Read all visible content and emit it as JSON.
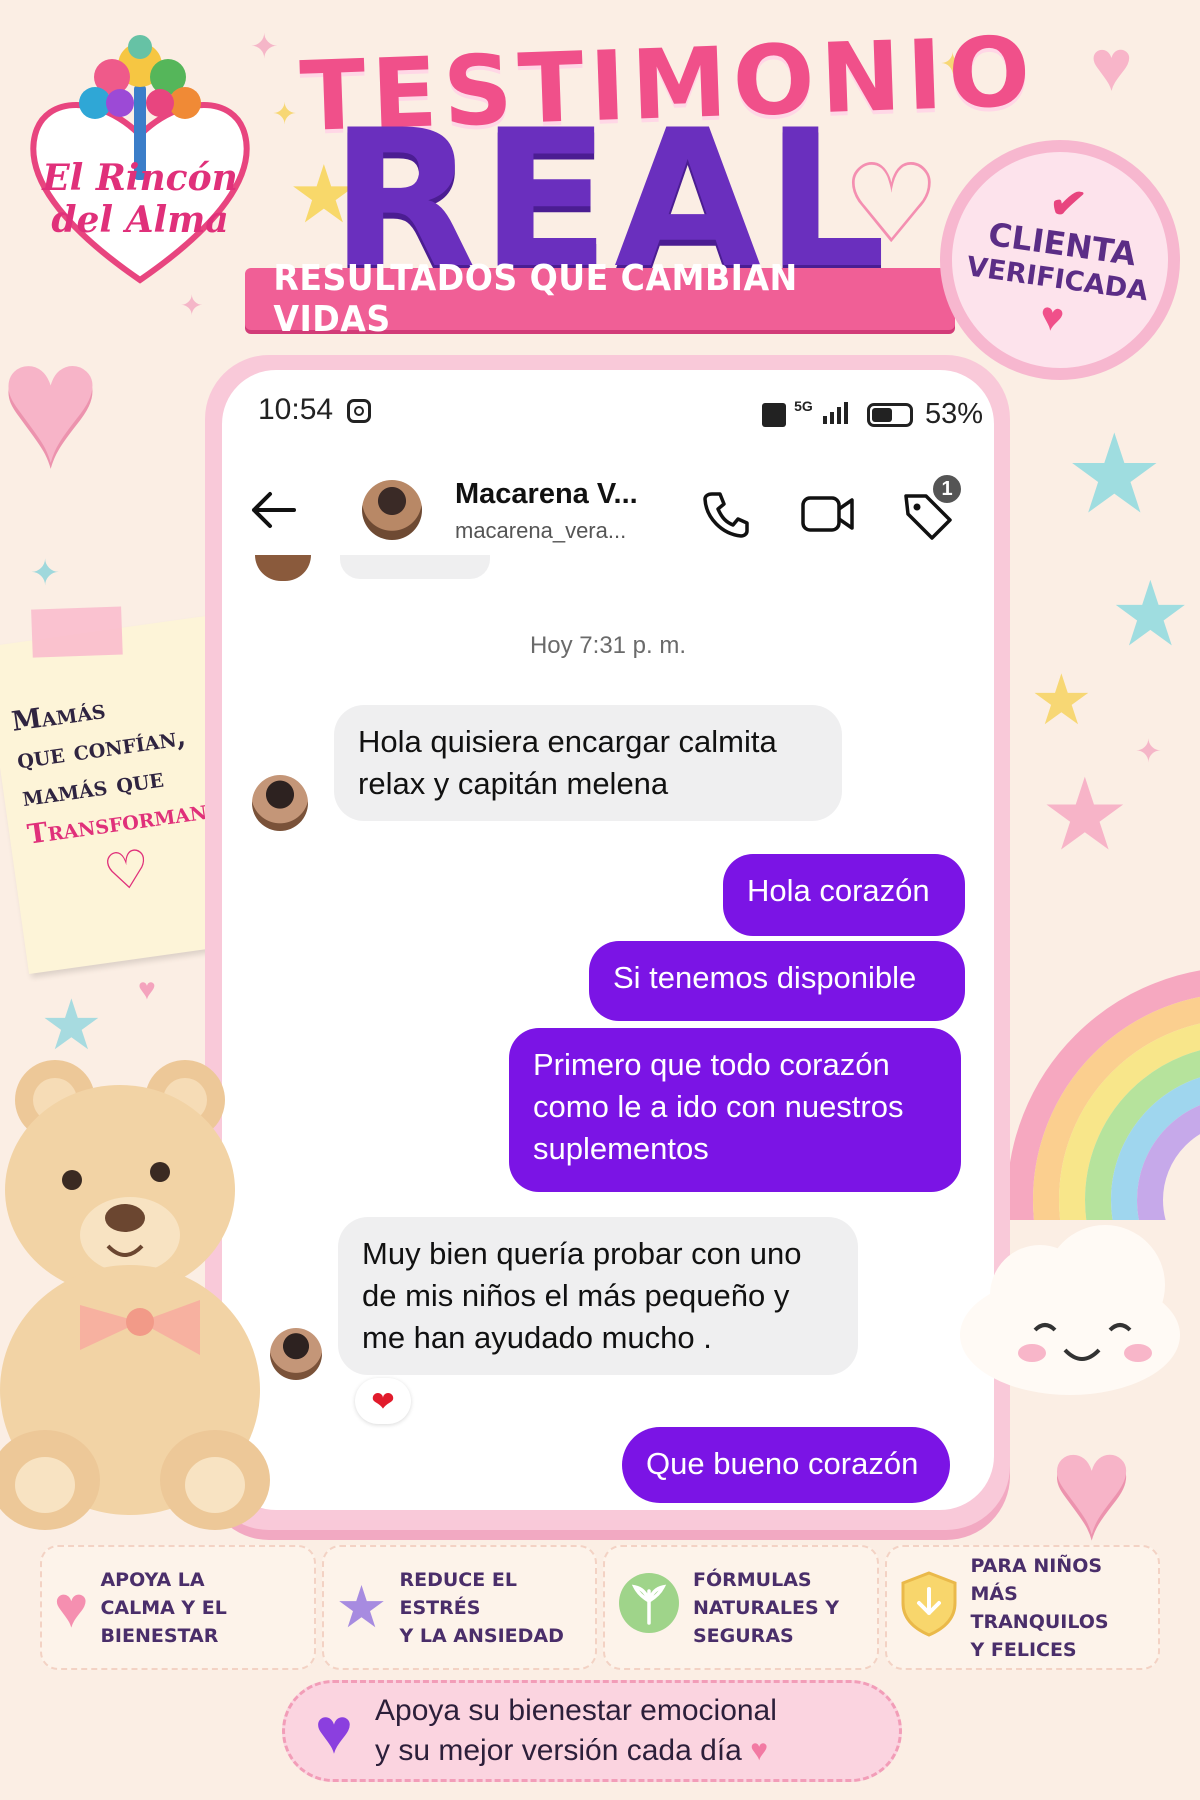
{
  "brand": {
    "line1": "El Rincón",
    "line2": "del Alma"
  },
  "title": {
    "top": "TESTIMONIO",
    "main": "REAL",
    "ribbon": "RESULTADOS QUE CAMBIAN VIDAS"
  },
  "badge": {
    "line1": "CLIENTA",
    "line2": "VERIFICADA"
  },
  "note": {
    "line1": "Mamás",
    "line2": "que confían,",
    "line3": "mamás que",
    "line4": "Transforman"
  },
  "phone": {
    "status": {
      "time": "10:54",
      "network": "5G",
      "battery": "53%"
    },
    "header": {
      "name": "Macarena V...",
      "handle": "macarena_vera...",
      "notification_count": "1"
    },
    "timestamp": "Hoy 7:31 p. m.",
    "messages": [
      {
        "from": "them",
        "text_1": "Hola quisiera encargar calmita",
        "text_2": "relax y capitán melena"
      },
      {
        "from": "me",
        "text": "Hola corazón"
      },
      {
        "from": "me",
        "text": "Si tenemos disponible"
      },
      {
        "from": "me",
        "text_1": "Primero que todo corazón",
        "text_2": "como le a ido con nuestros",
        "text_3": "suplementos"
      },
      {
        "from": "them",
        "text_1": "Muy bien quería probar con uno",
        "text_2": "de mis niños el más pequeño y",
        "text_3": "me  han ayudado mucho .",
        "reaction": "❤"
      },
      {
        "from": "me",
        "text": "Que bueno corazón"
      }
    ]
  },
  "features": [
    {
      "icon": "heart-icon",
      "line1": "APOYA LA",
      "line2": "CALMA Y EL",
      "line3": "BIENESTAR"
    },
    {
      "icon": "star-icon",
      "line1": "REDUCE EL ESTRÉS",
      "line2": "Y LA ANSIEDAD"
    },
    {
      "icon": "leaf-icon",
      "line1": "FÓRMULAS",
      "line2": "NATURALES Y",
      "line3": "SEGURAS"
    },
    {
      "icon": "shield-icon",
      "line1": "PARA NIÑOS",
      "line2": "MÁS TRANQUILOS",
      "line3": "Y FELICES"
    }
  ],
  "footer": {
    "line1": "Apoya su bienestar emocional",
    "line2": "y su mejor versión cada día"
  },
  "colors": {
    "background": "#fbeee4",
    "accent_pink": "#f05f96",
    "accent_purple": "#6a2fbe",
    "bubble_out": "#7b14e5",
    "bubble_in": "#efeff0"
  }
}
